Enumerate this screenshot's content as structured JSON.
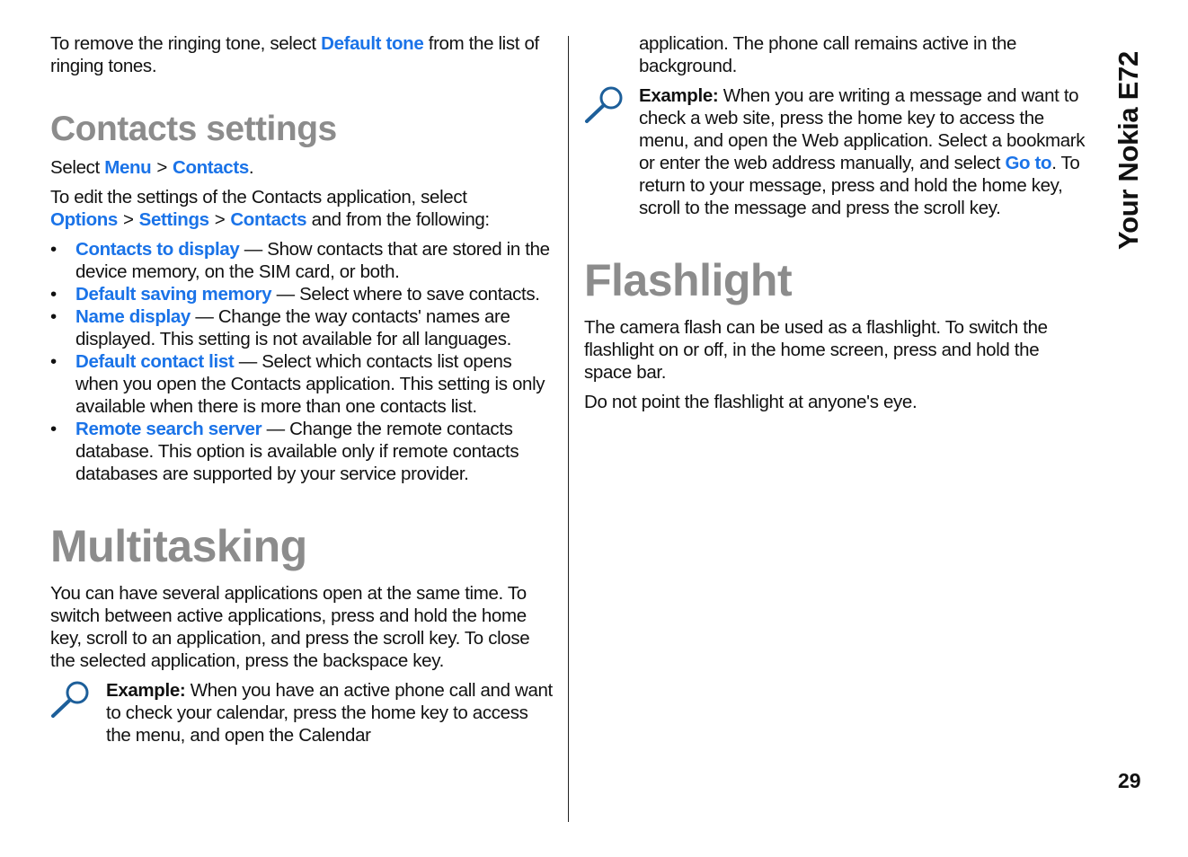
{
  "side_tab": "Your Nokia E72",
  "page_number": "29",
  "left": {
    "intro": {
      "pre": "To remove the ringing tone, select ",
      "link": "Default tone",
      "post": " from the list of ringing tones."
    },
    "contacts_settings": {
      "heading": "Contacts settings",
      "path_pre": "Select ",
      "path": [
        "Menu",
        "Contacts"
      ],
      "path_separator": ">",
      "path_post": ".",
      "edit_pre": "To edit the settings of the Contacts application, select ",
      "edit_path": [
        "Options",
        "Settings",
        "Contacts"
      ],
      "edit_post": " and from the following:",
      "bullet_glyph": "•",
      "items": [
        {
          "term": "Contacts to display",
          "desc": " — Show contacts that are stored in the device memory, on the SIM card, or both."
        },
        {
          "term": "Default saving memory",
          "desc": " — Select where to save contacts."
        },
        {
          "term": "Name display",
          "desc": " — Change the way contacts' names are displayed. This setting is not available for all languages."
        },
        {
          "term": "Default contact list",
          "desc": " — Select which contacts list opens when you open the Contacts application. This setting is only available when there is more than one contacts list."
        },
        {
          "term": "Remote search server",
          "desc": " — Change the remote contacts database. This option is available only if remote contacts databases are supported by your service provider."
        }
      ]
    },
    "multitasking": {
      "heading": "Multitasking",
      "body": "You can have several applications open at the same time. To switch between active applications, press and hold the home key, scroll to an application, and press the scroll key. To close the selected application, press the backspace key.",
      "example_label": "Example:",
      "example_text": " When you have an active phone call and want to check your calendar, press the home key to access the menu, and open the Calendar"
    }
  },
  "right": {
    "continued": "application. The phone call remains active in the background.",
    "example2": {
      "label": "Example:",
      "text_pre": " When you are writing a message and want to check a web site, press the home key to access the menu, and open the Web application. Select a bookmark or enter the web address manually, and select ",
      "link": "Go to",
      "text_post": ". To return to your message, press and hold the home key, scroll to the message and press the scroll key."
    },
    "flashlight": {
      "heading": "Flashlight",
      "body": "The camera flash can be used as a flashlight. To switch the flashlight on or off, in the home screen, press and hold the space bar.",
      "warning": "Do not point the flashlight at anyone's eye."
    }
  },
  "colors": {
    "link": "#1a73e8",
    "heading": "#8c8c8c",
    "icon": "#1d5f9a"
  }
}
